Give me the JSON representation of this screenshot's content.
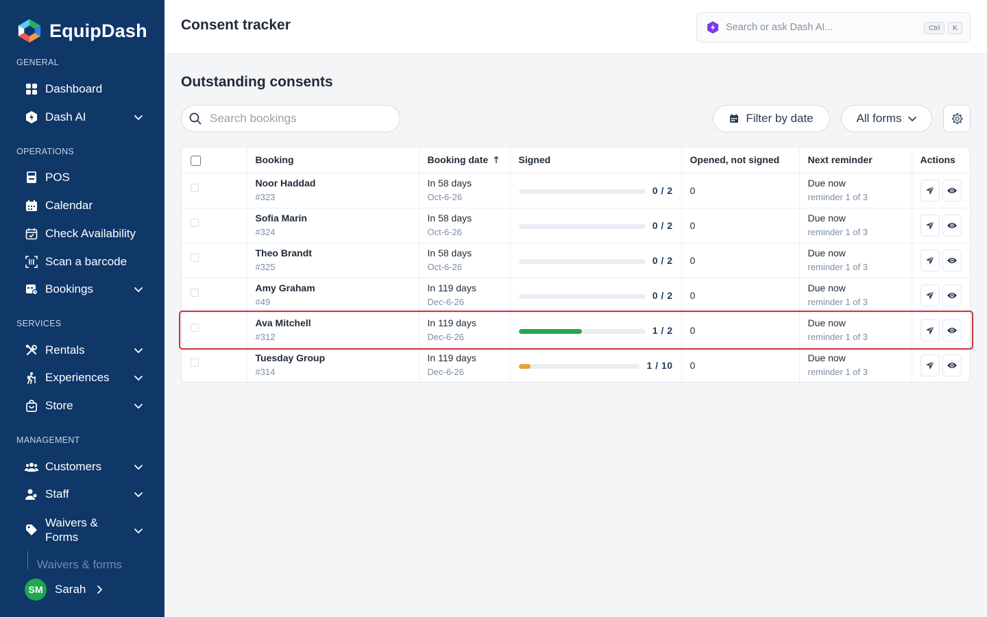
{
  "app": {
    "name": "EquipDash"
  },
  "header": {
    "title": "Consent tracker",
    "ai_search_placeholder": "Search or ask Dash AI...",
    "kbd_ctrl": "Ctrl",
    "kbd_k": "K"
  },
  "sidebar": {
    "sections": {
      "general": "GENERAL",
      "operations": "OPERATIONS",
      "services": "SERVICES",
      "management": "MANAGEMENT"
    },
    "items": {
      "dashboard": "Dashboard",
      "dash_ai": "Dash AI",
      "pos": "POS",
      "calendar": "Calendar",
      "check_availability": "Check Availability",
      "scan_barcode": "Scan a barcode",
      "bookings": "Bookings",
      "rentals": "Rentals",
      "experiences": "Experiences",
      "store": "Store",
      "customers": "Customers",
      "staff": "Staff",
      "waivers_line1": "Waivers &",
      "waivers_line2": "Forms",
      "waivers_sub": "Waivers & forms"
    },
    "user": {
      "initials": "SM",
      "name": "Sarah"
    }
  },
  "main": {
    "section_title": "Outstanding consents",
    "search_placeholder": "Search bookings",
    "filter_date_label": "Filter by date",
    "all_forms_label": "All forms",
    "table": {
      "columns": {
        "booking": "Booking",
        "booking_date": "Booking date",
        "signed": "Signed",
        "opened": "Opened, not signed",
        "next_reminder": "Next reminder",
        "actions": "Actions"
      },
      "rows": [
        {
          "name": "Noor Haddad",
          "id": "#323",
          "when": "In 58 days",
          "date": "Oct-6-26",
          "signed": 0,
          "total": 2,
          "signed_label": "0 / 2",
          "opened": "0",
          "reminder": "Due now",
          "reminder_sub": "reminder 1 of 3"
        },
        {
          "name": "Sofia Marin",
          "id": "#324",
          "when": "In 58 days",
          "date": "Oct-6-26",
          "signed": 0,
          "total": 2,
          "signed_label": "0 / 2",
          "opened": "0",
          "reminder": "Due now",
          "reminder_sub": "reminder 1 of 3"
        },
        {
          "name": "Theo Brandt",
          "id": "#325",
          "when": "In 58 days",
          "date": "Oct-6-26",
          "signed": 0,
          "total": 2,
          "signed_label": "0 / 2",
          "opened": "0",
          "reminder": "Due now",
          "reminder_sub": "reminder 1 of 3"
        },
        {
          "name": "Amy Graham",
          "id": "#49",
          "when": "In 119 days",
          "date": "Dec-6-26",
          "signed": 0,
          "total": 2,
          "signed_label": "0 / 2",
          "opened": "0",
          "reminder": "Due now",
          "reminder_sub": "reminder 1 of 3"
        },
        {
          "name": "Ava Mitchell",
          "id": "#312",
          "when": "In 119 days",
          "date": "Dec-6-26",
          "signed": 1,
          "total": 2,
          "signed_label": "1 / 2",
          "opened": "0",
          "reminder": "Due now",
          "reminder_sub": "reminder 1 of 3",
          "bar_color": "#28a44f"
        },
        {
          "name": "Tuesday Group",
          "id": "#314",
          "when": "In 119 days",
          "date": "Dec-6-26",
          "signed": 1,
          "total": 10,
          "signed_label": "1 / 10",
          "opened": "0",
          "reminder": "Due now",
          "reminder_sub": "reminder 1 of 3",
          "bar_color": "#e8a230"
        }
      ]
    }
  },
  "colors": {
    "sidebar_bg": "#0f3768",
    "highlight_border": "#d0303a",
    "progress_green": "#28a44f",
    "progress_orange": "#e8a230",
    "ai_purple": "#7c3aed"
  }
}
